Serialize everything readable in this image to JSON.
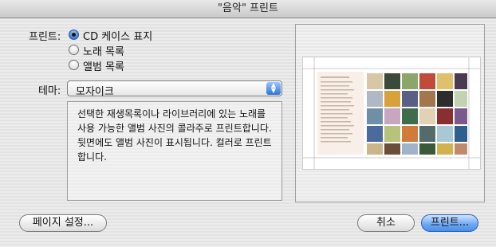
{
  "window": {
    "title": "\"음악\" 프린트"
  },
  "print_type": {
    "label": "프린트:",
    "options": [
      "CD 케이스 표지",
      "노래 목록",
      "앨범 목록"
    ],
    "selected_index": 0
  },
  "theme": {
    "label": "테마:",
    "selected": "모자이크",
    "description": "선택한 재생목록이나 라이브러리에 있는 노래를 사용 가능한 앨범 사진의 콜라주로 프린트합니다. 뒷면에도 앨범 사진이 표시됩니다. 컬러로 프린트합니다."
  },
  "buttons": {
    "page_setup": "페이지 설정...",
    "cancel": "취소",
    "print": "프린트..."
  },
  "colors": {
    "default_button": "#5b9cf0",
    "selected_radio": "#3a79cc"
  }
}
